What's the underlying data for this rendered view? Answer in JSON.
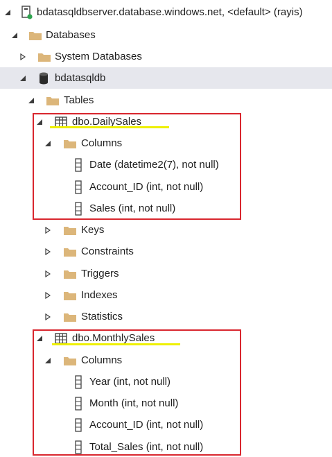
{
  "tree": {
    "server": {
      "label": "bdatasqldbserver.database.windows.net, <default> (rayis)"
    },
    "databases": {
      "label": "Databases"
    },
    "system_databases": {
      "label": "System Databases"
    },
    "db": {
      "label": "bdatasqldb"
    },
    "tables": {
      "label": "Tables"
    },
    "daily_sales": {
      "label": "dbo.DailySales",
      "columns_label": "Columns",
      "columns": [
        "Date (datetime2(7), not null)",
        "Account_ID (int, not null)",
        "Sales (int, not null)"
      ],
      "subfolders": [
        "Keys",
        "Constraints",
        "Triggers",
        "Indexes",
        "Statistics"
      ]
    },
    "monthly_sales": {
      "label": "dbo.MonthlySales",
      "columns_label": "Columns",
      "columns": [
        "Year (int, not null)",
        "Month (int, not null)",
        "Account_ID (int, not null)",
        "Total_Sales (int, not null)"
      ]
    }
  },
  "colors": {
    "highlight_box": "#d9262e",
    "underline": "#eef000",
    "folder": "#dcb67a",
    "selected_row": "#e6e7ed"
  }
}
